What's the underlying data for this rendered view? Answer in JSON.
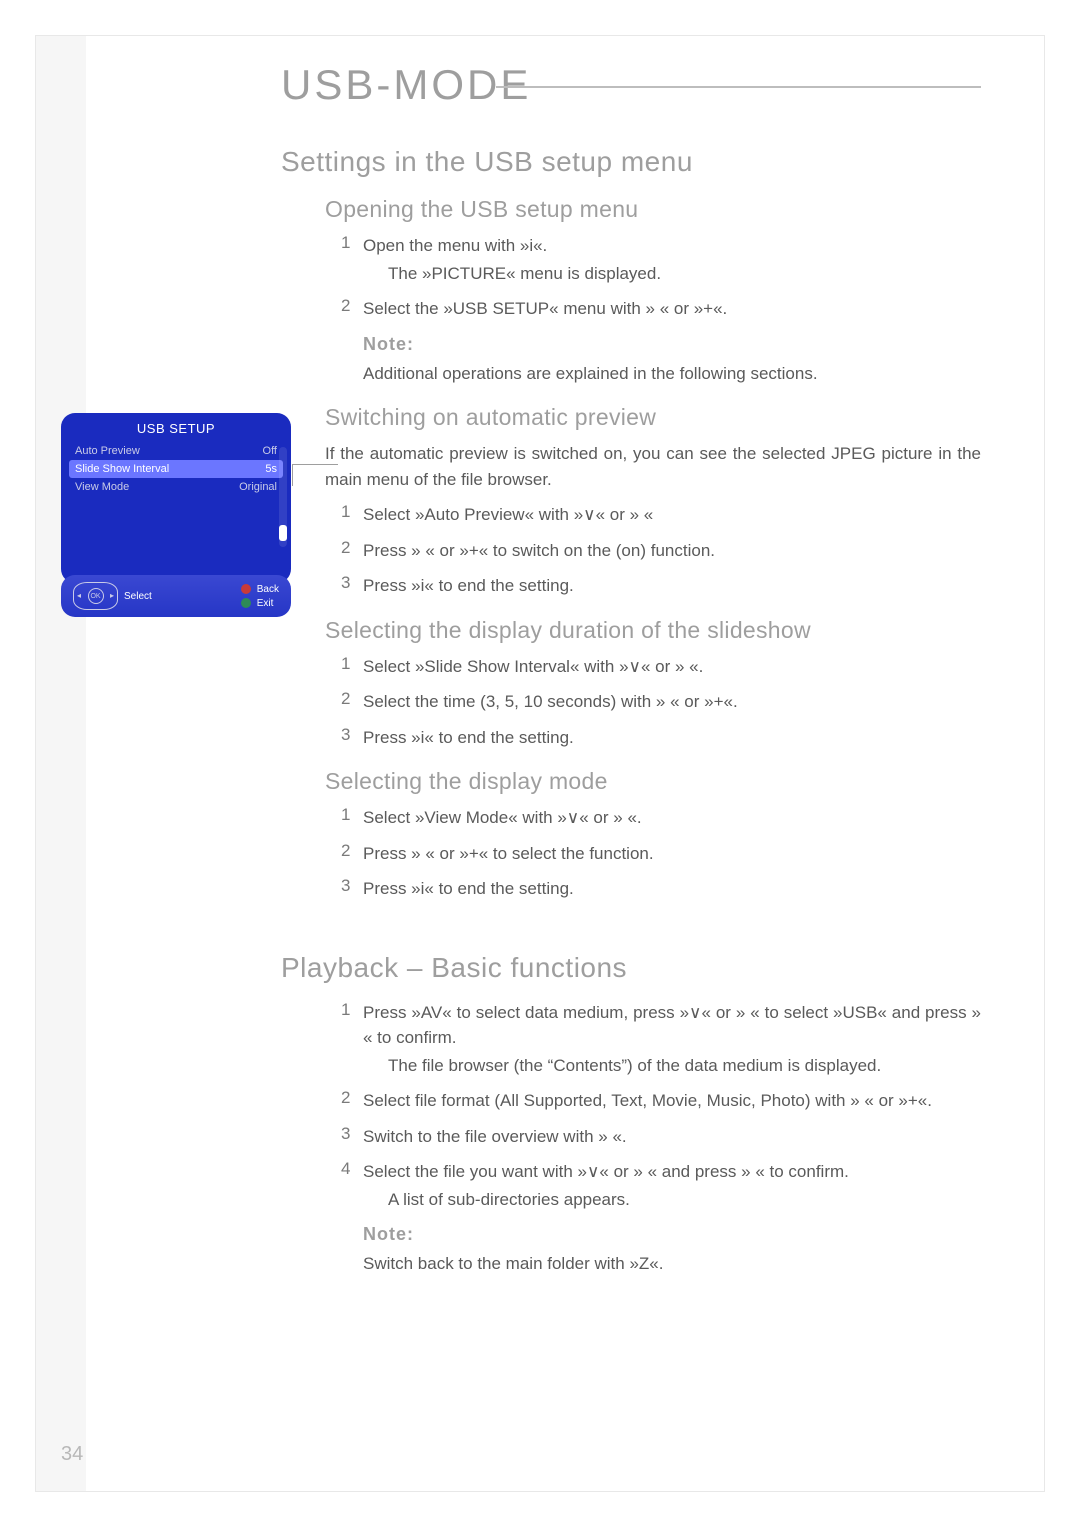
{
  "title": "USB-MODE",
  "sections": {
    "settings": {
      "heading": "Settings in the USB setup menu",
      "opening": {
        "heading": "Opening the USB setup menu",
        "steps": [
          {
            "n": "1",
            "body": "Open the menu with »i«.",
            "indent": "The »PICTURE« menu is displayed."
          },
          {
            "n": "2",
            "body": "Select the »USB SETUP« menu with »  « or »+«."
          }
        ],
        "note_label": "Note:",
        "note_text": "Additional operations are explained in the following sections."
      },
      "auto": {
        "heading": "Switching on automatic preview",
        "intro": "If the automatic preview is switched on, you can see the selected JPEG picture in the main menu of the file browser.",
        "steps": [
          {
            "n": "1",
            "body": "Select »Auto Preview« with »∨« or » «"
          },
          {
            "n": "2",
            "body": "Press »  « or »+« to switch on the (on) function."
          },
          {
            "n": "3",
            "body": "Press »i« to end the setting."
          }
        ]
      },
      "duration": {
        "heading": "Selecting the display duration of the slideshow",
        "steps": [
          {
            "n": "1",
            "body": "Select »Slide Show Interval« with »∨« or » «."
          },
          {
            "n": "2",
            "body": "Select the time (3, 5, 10 seconds) with »  « or »+«."
          },
          {
            "n": "3",
            "body": "Press »i« to end the setting."
          }
        ]
      },
      "mode": {
        "heading": "Selecting the display mode",
        "steps": [
          {
            "n": "1",
            "body": "Select »View Mode« with »∨« or » «."
          },
          {
            "n": "2",
            "body": "Press »  « or »+« to select the function."
          },
          {
            "n": "3",
            "body": "Press »i« to end the setting."
          }
        ]
      }
    },
    "playback": {
      "heading": "Playback – Basic functions",
      "steps": [
        {
          "n": "1",
          "body": "Press »AV« to select data medium, press »∨« or » « to select »USB« and press » « to confirm.",
          "indent": "The file browser (the “Contents”) of the data medium is displayed."
        },
        {
          "n": "2",
          "body": "Select file format (All Supported, Text, Movie, Music, Photo) with »  « or »+«."
        },
        {
          "n": "3",
          "body": "Switch to the file overview with » «."
        },
        {
          "n": "4",
          "body": "Select the file you want with »∨« or » « and press » « to confirm.",
          "indent": "A list of sub-directories appears."
        }
      ],
      "note_label": "Note:",
      "note_text": "Switch back to the main folder with »Z«."
    }
  },
  "osd": {
    "title": "USB SETUP",
    "rows": [
      {
        "label": "Auto Preview",
        "value": "Off"
      },
      {
        "label": "Slide Show Interval",
        "value": "5s"
      },
      {
        "label": "View Mode",
        "value": "Original"
      }
    ],
    "select": "Select",
    "back": "Back",
    "exit": "Exit",
    "ok": "OK"
  },
  "page_number": "34"
}
